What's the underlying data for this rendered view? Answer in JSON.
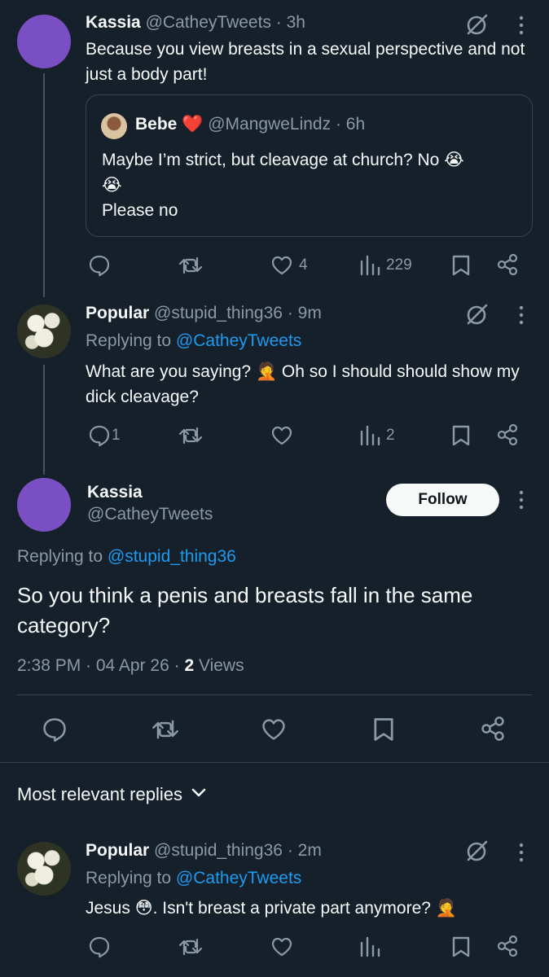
{
  "colors": {
    "background": "#15202b",
    "text": "#f7f9f9",
    "muted": "#8b98a5",
    "link": "#1d9bf0",
    "avatar_purple": "#7a4fc4",
    "heart_emoji": "#e0245e"
  },
  "tweet1": {
    "name": "Kassia",
    "handle": "@CatheyTweets",
    "time": "· 3h",
    "text": "Because you view breasts in a sexual perspective and not just a body part!",
    "quote": {
      "name": "Bebe",
      "name_emoji": "❤️",
      "handle": "@MangweLindz",
      "time": "· 6h",
      "line1": "Maybe I’m strict, but cleavage at church? No 😭",
      "line2": "😭",
      "line3": "Please no"
    },
    "likes": "4",
    "views": "229"
  },
  "tweet2": {
    "name": "Popular",
    "handle": "@stupid_thing36",
    "time": "· 9m",
    "replying_label": "Replying to",
    "replying_handle": "@CatheyTweets",
    "text": "What are you saying? 🤦 Oh so I should should show my dick cleavage?",
    "replies": "1",
    "views": "2"
  },
  "main": {
    "name": "Kassia",
    "handle": "@CatheyTweets",
    "follow_label": "Follow",
    "replying_label": "Replying to",
    "replying_handle": "@stupid_thing36",
    "text": "So you think a penis and breasts fall in the same category?",
    "timestamp": "2:38 PM · 04 Apr 26 · ",
    "views_count": "2",
    "views_label": " Views"
  },
  "sort_label": "Most relevant replies",
  "reply1": {
    "name": "Popular",
    "handle": "@stupid_thing36",
    "time": "· 2m",
    "replying_label": "Replying to",
    "replying_handle": "@CatheyTweets",
    "text": "Jesus 😳. Isn't breast a private part anymore? 🤦"
  },
  "icons": [
    "grok-icon",
    "more-icon",
    "reply-icon",
    "retweet-icon",
    "like-icon",
    "views-icon",
    "bookmark-icon",
    "share-icon",
    "chevron-down-icon"
  ]
}
